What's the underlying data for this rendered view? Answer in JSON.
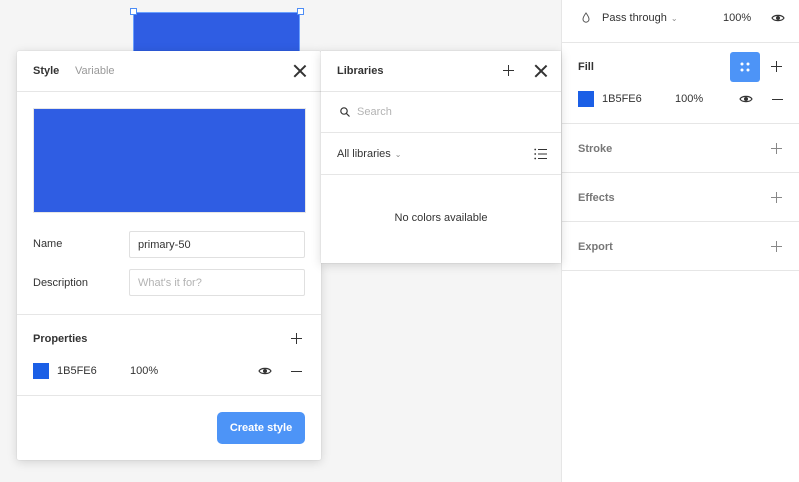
{
  "layer": {
    "blend_mode": "Pass through",
    "opacity": "100%"
  },
  "fill": {
    "title": "Fill",
    "hex": "1B5FE6",
    "opacity": "100%",
    "color": "#1b5fe6"
  },
  "sections": {
    "stroke": "Stroke",
    "effects": "Effects",
    "export": "Export"
  },
  "style_panel": {
    "tab_style": "Style",
    "tab_variable": "Variable",
    "name_label": "Name",
    "name_value": "primary-50",
    "description_label": "Description",
    "description_placeholder": "What's it for?",
    "properties_title": "Properties",
    "property_hex": "1B5FE6",
    "property_opacity": "100%",
    "create_button": "Create style",
    "preview_color": "#2f5de3"
  },
  "libraries": {
    "title": "Libraries",
    "search_placeholder": "Search",
    "filter_label": "All libraries",
    "empty_message": "No colors available"
  },
  "colors": {
    "accent": "#4d94f7",
    "selection": "#4d8df6"
  }
}
